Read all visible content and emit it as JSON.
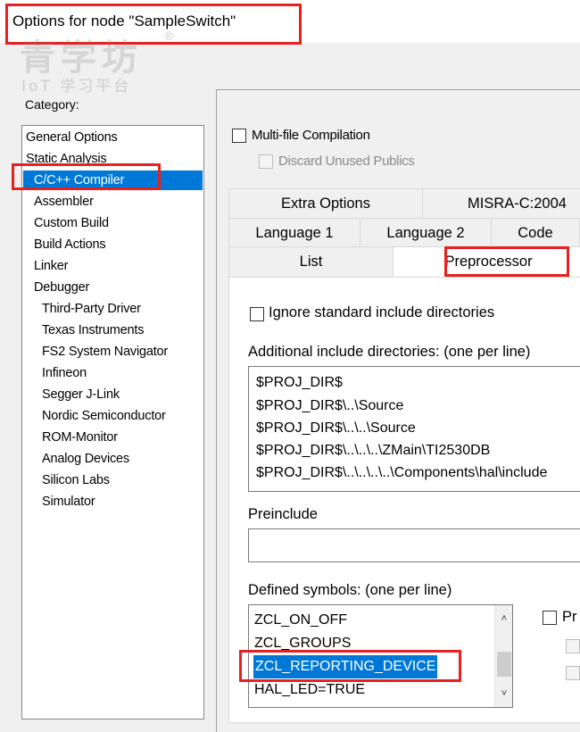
{
  "window": {
    "title": "Options for node \"SampleSwitch\""
  },
  "watermark": {
    "main": "青学坊",
    "registered": "®",
    "sub": "IoT 学习平台"
  },
  "category": {
    "label": "Category:",
    "items": [
      {
        "label": "General Options",
        "level": 0,
        "selected": false
      },
      {
        "label": "Static Analysis",
        "level": 0,
        "selected": false
      },
      {
        "label": "C/C++ Compiler",
        "level": 1,
        "selected": true
      },
      {
        "label": "Assembler",
        "level": 1,
        "selected": false
      },
      {
        "label": "Custom Build",
        "level": 1,
        "selected": false
      },
      {
        "label": "Build Actions",
        "level": 1,
        "selected": false
      },
      {
        "label": "Linker",
        "level": 1,
        "selected": false
      },
      {
        "label": "Debugger",
        "level": 1,
        "selected": false
      },
      {
        "label": "Third-Party Driver",
        "level": 2,
        "selected": false
      },
      {
        "label": "Texas Instruments",
        "level": 2,
        "selected": false
      },
      {
        "label": "FS2 System Navigator",
        "level": 2,
        "selected": false
      },
      {
        "label": "Infineon",
        "level": 2,
        "selected": false
      },
      {
        "label": "Segger J-Link",
        "level": 2,
        "selected": false
      },
      {
        "label": "Nordic Semiconductor",
        "level": 2,
        "selected": false
      },
      {
        "label": "ROM-Monitor",
        "level": 2,
        "selected": false
      },
      {
        "label": "Analog Devices",
        "level": 2,
        "selected": false
      },
      {
        "label": "Silicon Labs",
        "level": 2,
        "selected": false
      },
      {
        "label": "Simulator",
        "level": 2,
        "selected": false
      }
    ]
  },
  "options": {
    "multi_file": {
      "label": "Multi-file Compilation",
      "checked": false
    },
    "discard_unused": {
      "label": "Discard Unused Publics",
      "checked": false,
      "disabled": true
    }
  },
  "tabs": {
    "row1": [
      "Extra Options",
      "MISRA-C:2004"
    ],
    "row2": [
      "Language 1",
      "Language 2",
      "Code"
    ],
    "row3": [
      "List",
      "Preprocessor"
    ],
    "active": "Preprocessor"
  },
  "preprocessor": {
    "ignore_std": {
      "label": "Ignore standard include directories",
      "checked": false
    },
    "include_label": "Additional include directories: (one per line)",
    "include_dirs": [
      "$PROJ_DIR$",
      "$PROJ_DIR$\\..\\Source",
      "$PROJ_DIR$\\..\\..\\Source",
      "$PROJ_DIR$\\..\\..\\..\\ZMain\\TI2530DB",
      "$PROJ_DIR$\\..\\..\\..\\..\\Components\\hal\\include"
    ],
    "preinclude_label": "Preinclude",
    "preinclude_value": "",
    "defined_label": "Defined symbols: (one per line)",
    "defined_symbols": [
      {
        "text": "ZCL_ON_OFF",
        "selected": false
      },
      {
        "text": "ZCL_GROUPS",
        "selected": false
      },
      {
        "text": "ZCL_REPORTING_DEVICE",
        "selected": true
      },
      {
        "text": "HAL_LED=TRUE",
        "selected": false
      }
    ],
    "preprocessor_output_label": "Pr"
  },
  "colors": {
    "highlight_box": "#e8201f",
    "selection": "#0078d7"
  }
}
